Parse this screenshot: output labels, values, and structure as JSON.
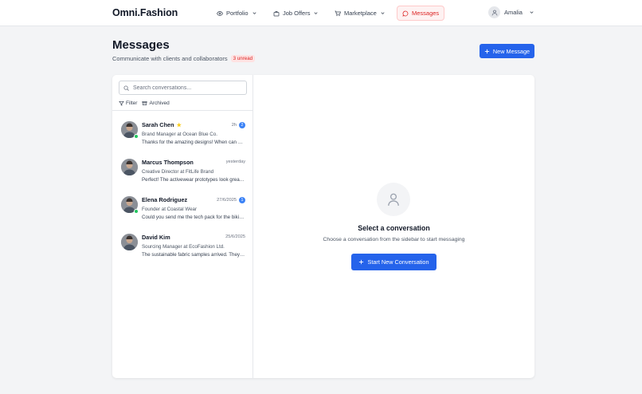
{
  "brand": "Omni.Fashion",
  "nav": {
    "portfolio": "Portfolio",
    "job_offers": "Job Offers",
    "marketplace": "Marketplace",
    "messages": "Messages"
  },
  "user": {
    "name": "Amalia"
  },
  "header": {
    "title": "Messages",
    "subtitle": "Communicate with clients and collaborators",
    "unread_badge": "3 unread",
    "new_message_label": "New Message"
  },
  "sidebar": {
    "search_placeholder": "Search conversations...",
    "filter_label": "Filter",
    "archived_label": "Archived",
    "conversations": [
      {
        "name": "Sarah Chen",
        "starred": true,
        "time": "2h",
        "unread": "2",
        "online": true,
        "role": "Brand Manager at Ocean Blue Co.",
        "preview": "Thanks for the amazing designs! When can we schedule the next review?"
      },
      {
        "name": "Marcus Thompson",
        "starred": false,
        "time": "yesterday",
        "unread": "",
        "online": false,
        "role": "Creative Director at FitLife Brand",
        "preview": "Perfect! The activewear prototypes look great so far."
      },
      {
        "name": "Elena Rodriguez",
        "starred": false,
        "time": "27/6/2025",
        "unread": "1",
        "online": true,
        "role": "Founder at Coastal Wear",
        "preview": "Could you send me the tech pack for the bikini collection?"
      },
      {
        "name": "David Kim",
        "starred": false,
        "time": "25/6/2025",
        "unread": "",
        "online": false,
        "role": "Sourcing Manager at EcoFashion Ltd.",
        "preview": "The sustainable fabric samples arrived. They look excellent."
      }
    ]
  },
  "empty_state": {
    "title": "Select a conversation",
    "subtitle": "Choose a conversation from the sidebar to start messaging",
    "button_label": "Start New Conversation"
  },
  "colors": {
    "accent": "#2563eb",
    "active_nav": "#dc2626",
    "online": "#22c55e",
    "star": "#facc15"
  }
}
